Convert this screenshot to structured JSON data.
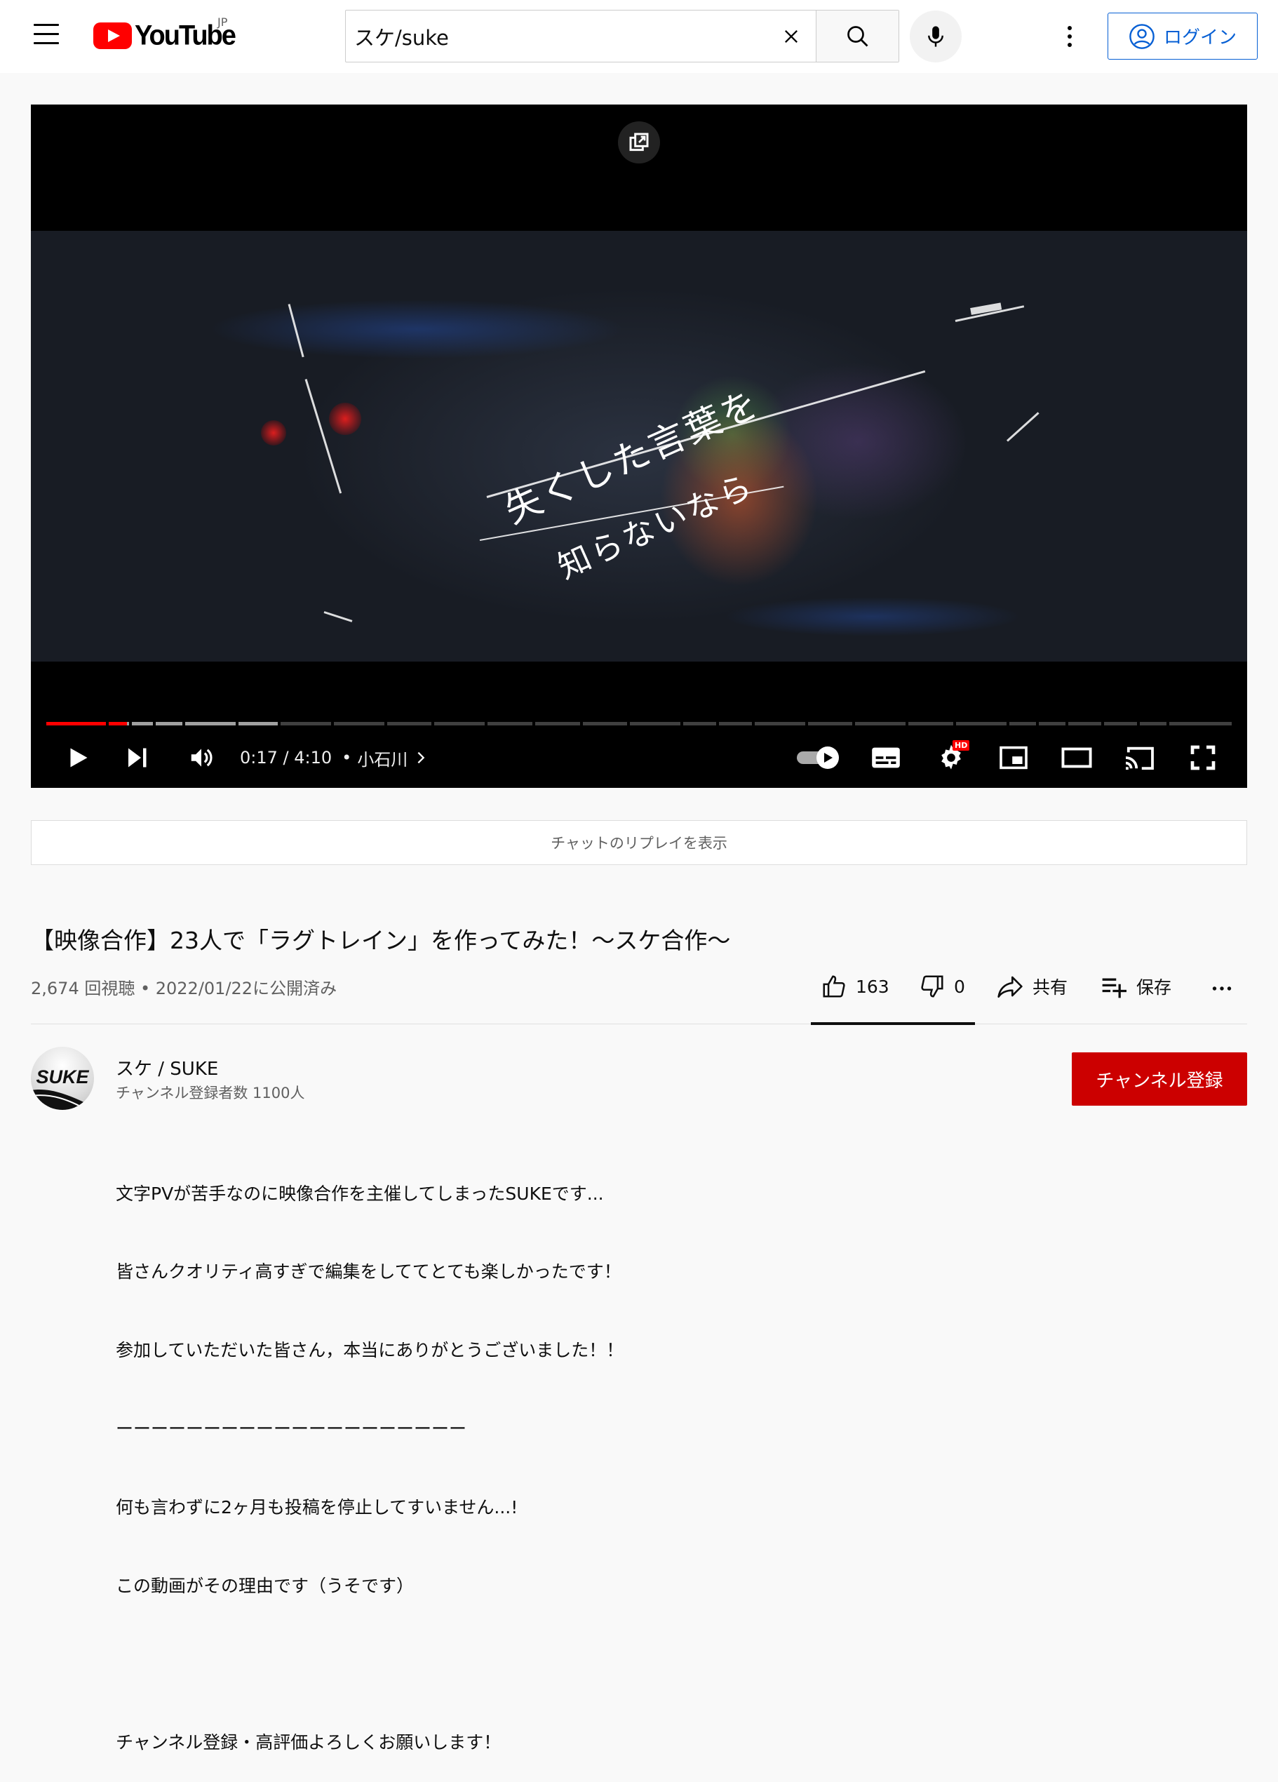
{
  "header": {
    "logo_text": "YouTube",
    "region": "JP",
    "search_value": "スケ/suke",
    "login_label": "ログイン"
  },
  "player": {
    "lyrics_line1": "失くした言葉を",
    "lyrics_line2": "知らないなら",
    "progress_played_fraction": 0.068,
    "progress_buffered_fraction": 0.195,
    "time_current": "0:17",
    "time_total": "4:10",
    "time_separator": " / ",
    "chapter_bullet": "•",
    "chapter": "小石川",
    "hd_badge": "HD"
  },
  "chat_replay_label": "チャットのリプレイを表示",
  "video": {
    "title": "【映像合作】23人で「ラグトレイン」を作ってみた！～スケ合作～",
    "meta": "2,674 回視聴 • 2022/01/22に公開済み",
    "likes": "163",
    "dislikes": "0",
    "share_label": "共有",
    "save_label": "保存"
  },
  "channel": {
    "avatar_text": "SUKE",
    "name": "スケ / SUKE",
    "subscribers": "チャンネル登録者数 1100人",
    "subscribe_label": "チャンネル登録"
  },
  "description": [
    "文字PVが苦手なのに映像合作を主催してしまったSUKEです...",
    "皆さんクオリティ高すぎで編集をしててとても楽しかったです！",
    "参加していただいた皆さん，本当にありがとうございました！！",
    "ーーーーーーーーーーーーーーーーーーーー",
    "何も言わずに2ヶ月も投稿を停止してすいません...!",
    "この動画がその理由です（うそです）",
    "",
    "チャンネル登録・高評価よろしくお願いします！"
  ],
  "colors": {
    "brand_red": "#ff0000",
    "subscribe_red": "#cc0000",
    "link_blue": "#065fd4"
  }
}
